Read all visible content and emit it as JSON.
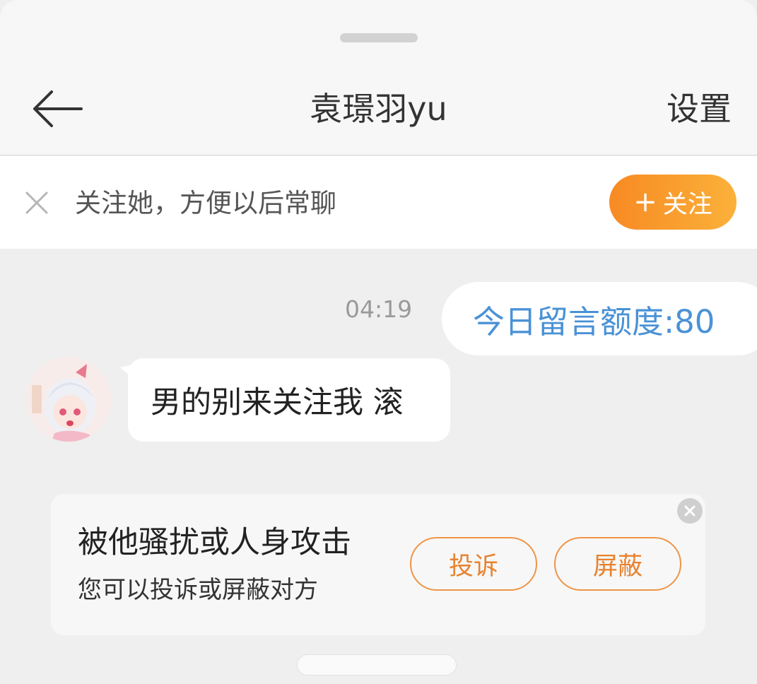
{
  "header": {
    "title": "袁璟羽yu",
    "settings_label": "设置"
  },
  "follow_bar": {
    "prompt": "关注她，方便以后常聊",
    "button_plus": "+",
    "button_label": "关注"
  },
  "messages": [
    {
      "direction": "outgoing",
      "time": "04:19",
      "text": "今日留言额度:80"
    },
    {
      "direction": "incoming",
      "text": "男的别来关注我 滚"
    }
  ],
  "report_card": {
    "title": "被他骚扰或人身攻击",
    "subtitle": "您可以投诉或屏蔽对方",
    "report_label": "投诉",
    "block_label": "屏蔽"
  },
  "icons": {
    "back": "arrow-left-icon",
    "dismiss": "close-icon",
    "card_close": "close-circle-icon"
  },
  "colors": {
    "accent_orange": "#f78a23",
    "outgoing_text": "#4a92d6",
    "pill_border": "#ef9446"
  }
}
